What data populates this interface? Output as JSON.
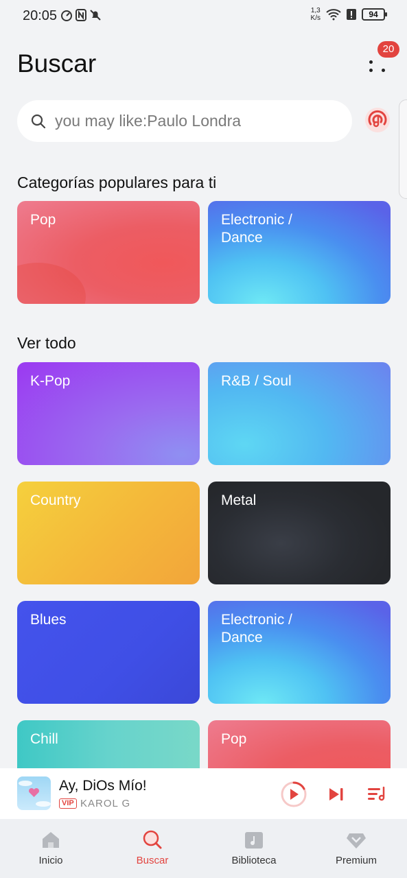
{
  "status_bar": {
    "time": "20:05",
    "speed_value": "1,3",
    "speed_unit": "K/s",
    "battery": "94"
  },
  "header": {
    "title": "Buscar",
    "notification_count": "20"
  },
  "search": {
    "placeholder": "you may like:Paulo Londra"
  },
  "popular": {
    "title": "Categorías populares para ti",
    "cards": [
      {
        "label": "Pop"
      },
      {
        "label": "Electronic / Dance"
      }
    ]
  },
  "all": {
    "title": "Ver todo",
    "cards": [
      {
        "label": "K-Pop"
      },
      {
        "label": "R&B / Soul"
      },
      {
        "label": "Country"
      },
      {
        "label": "Metal"
      },
      {
        "label": "Blues"
      },
      {
        "label": "Electronic / Dance"
      },
      {
        "label": "Chill"
      },
      {
        "label": "Pop"
      }
    ]
  },
  "player": {
    "song": "Ay, DiOs Mío!",
    "vip": "VIP",
    "artist": "KAROL G"
  },
  "nav": [
    {
      "label": "Inicio",
      "icon": "home-icon"
    },
    {
      "label": "Buscar",
      "icon": "search-icon"
    },
    {
      "label": "Biblioteca",
      "icon": "library-icon"
    },
    {
      "label": "Premium",
      "icon": "diamond-icon"
    }
  ],
  "colors": {
    "accent": "#e2443f",
    "background": "#f2f3f5"
  }
}
